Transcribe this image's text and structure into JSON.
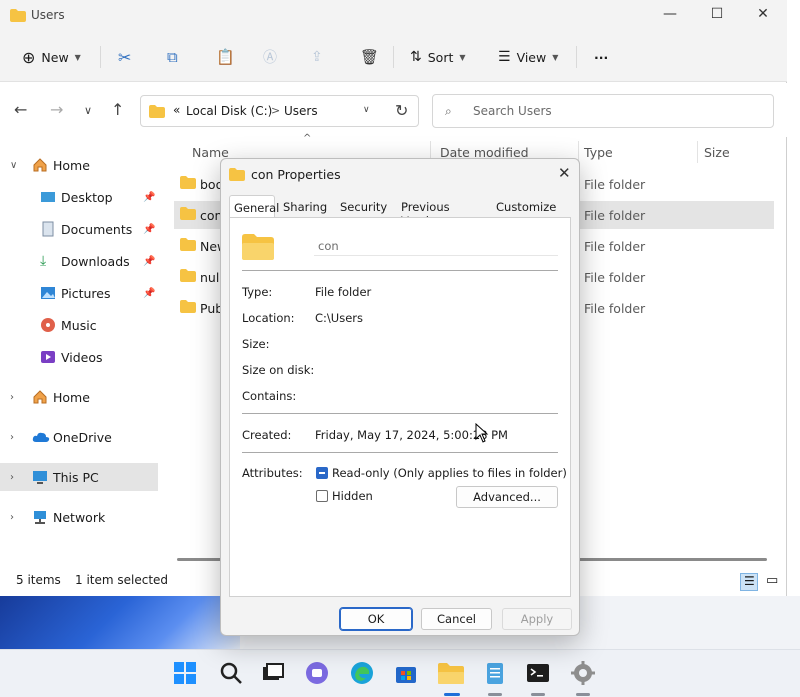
{
  "window": {
    "title": "Users"
  },
  "toolbar": {
    "new_label": "New",
    "sort_label": "Sort",
    "view_label": "View",
    "more_label": "···"
  },
  "address": {
    "chevron": "«",
    "segments": [
      "Local Disk (C:)",
      "Users"
    ],
    "separator": ">"
  },
  "search": {
    "placeholder": "Search Users"
  },
  "sidebar": {
    "items": [
      {
        "label": "Home",
        "icon": "home-icon"
      },
      {
        "label": "Desktop",
        "icon": "desktop-icon"
      },
      {
        "label": "Documents",
        "icon": "documents-icon"
      },
      {
        "label": "Downloads",
        "icon": "downloads-icon"
      },
      {
        "label": "Pictures",
        "icon": "pictures-icon"
      },
      {
        "label": "Music",
        "icon": "music-icon"
      },
      {
        "label": "Videos",
        "icon": "videos-icon"
      },
      {
        "label": "Home",
        "icon": "home-icon"
      },
      {
        "label": "OneDrive",
        "icon": "cloud-icon"
      },
      {
        "label": "This PC",
        "icon": "pc-icon"
      },
      {
        "label": "Network",
        "icon": "network-icon"
      }
    ]
  },
  "columns": {
    "name": "Name",
    "date": "Date modified",
    "type": "Type",
    "size": "Size"
  },
  "files": [
    {
      "name": "boo",
      "type": "File folder"
    },
    {
      "name": "con",
      "type": "File folder"
    },
    {
      "name": "New",
      "type": "File folder"
    },
    {
      "name": "nul.",
      "type": "File folder"
    },
    {
      "name": "Pub",
      "type": "File folder"
    }
  ],
  "status": {
    "count": "5 items",
    "selected": "1 item selected"
  },
  "dialog": {
    "title": "con Properties",
    "tabs": [
      "General",
      "Sharing",
      "Security",
      "Previous Versions",
      "Customize"
    ],
    "name_value": "con",
    "type_label": "Type:",
    "type_value": "File folder",
    "location_label": "Location:",
    "location_value": "C:\\Users",
    "size_label": "Size:",
    "size_on_disk_label": "Size on disk:",
    "contains_label": "Contains:",
    "created_label": "Created:",
    "created_value": "Friday, May 17, 2024, 5:00:28 PM",
    "attributes_label": "Attributes:",
    "readonly_label": "Read-only (Only applies to files in folder)",
    "readonly_checked": true,
    "hidden_label": "Hidden",
    "hidden_checked": false,
    "advanced_label": "Advanced...",
    "ok_label": "OK",
    "cancel_label": "Cancel",
    "apply_label": "Apply"
  },
  "taskbar": {
    "icons": [
      "start-icon",
      "search-icon",
      "task-view-icon",
      "teams-icon",
      "edge-icon",
      "store-icon",
      "file-explorer-icon",
      "notepad-icon",
      "terminal-icon",
      "settings-icon"
    ]
  },
  "colors": {
    "accent": "#2a68c8",
    "folder": "#f6c343",
    "selection": "#e4e4e4"
  }
}
